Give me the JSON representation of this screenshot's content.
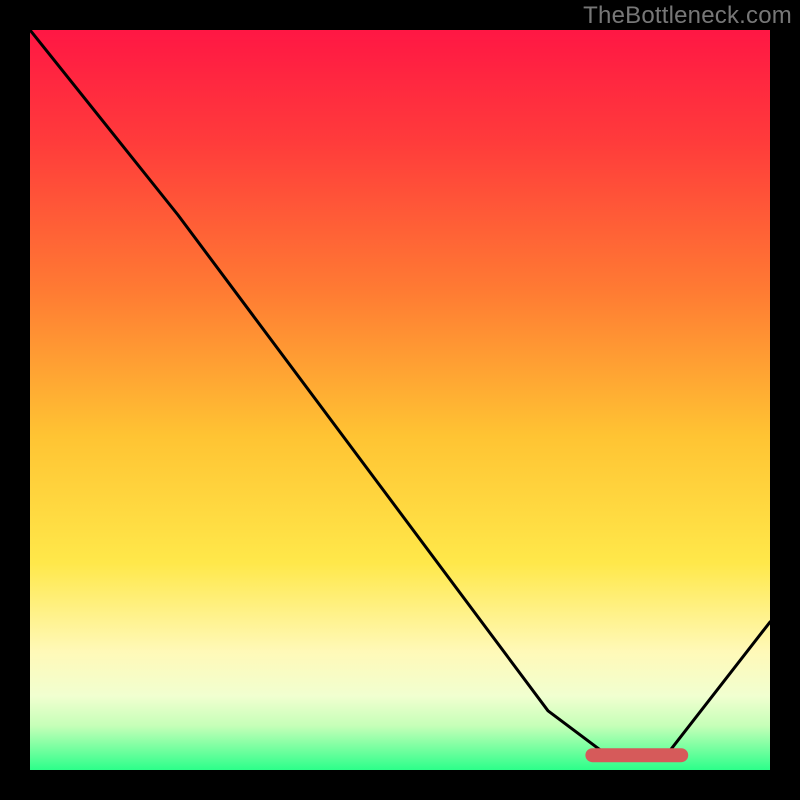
{
  "watermark": "TheBottleneck.com",
  "chart_data": {
    "type": "line",
    "title": "",
    "xlabel": "",
    "ylabel": "",
    "xlim": [
      0,
      100
    ],
    "ylim": [
      0,
      100
    ],
    "series": [
      {
        "name": "curve",
        "x": [
          0,
          20,
          70,
          78,
          86,
          100
        ],
        "values": [
          100,
          75,
          8,
          2,
          2,
          20
        ]
      }
    ],
    "sweet_spot": {
      "x_start": 76,
      "x_end": 88,
      "y": 2
    },
    "background": {
      "type": "vertical-gradient",
      "stops": [
        {
          "offset": 0.0,
          "color": "#ff1744"
        },
        {
          "offset": 0.15,
          "color": "#ff3b3b"
        },
        {
          "offset": 0.35,
          "color": "#ff7a33"
        },
        {
          "offset": 0.55,
          "color": "#ffc433"
        },
        {
          "offset": 0.72,
          "color": "#ffe84a"
        },
        {
          "offset": 0.84,
          "color": "#fff9b8"
        },
        {
          "offset": 0.9,
          "color": "#f1ffd0"
        },
        {
          "offset": 0.94,
          "color": "#c6ffb8"
        },
        {
          "offset": 1.0,
          "color": "#2cff8a"
        }
      ]
    }
  }
}
